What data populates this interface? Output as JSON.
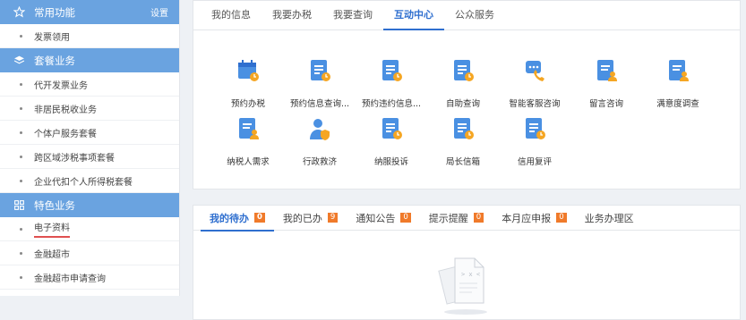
{
  "sidebar": {
    "sections": [
      {
        "title": "常用功能",
        "settings": "设置",
        "icon": "star-icon",
        "items": [
          "发票领用"
        ]
      },
      {
        "title": "套餐业务",
        "icon": "layers-icon",
        "items": [
          "代开发票业务",
          "非居民税收业务",
          "个体户服务套餐",
          "跨区域涉税事项套餐",
          "企业代扣个人所得税套餐"
        ]
      },
      {
        "title": "特色业务",
        "icon": "grid-icon",
        "items": [
          "电子资料",
          "金融超市",
          "金融超市申请查询"
        ]
      }
    ]
  },
  "top_tabs": [
    "我的信息",
    "我要办税",
    "我要查询",
    "互动中心",
    "公众服务"
  ],
  "active_top_tab": "互动中心",
  "services": [
    {
      "label": "预约办税",
      "icon": "calendar-clock-icon"
    },
    {
      "label": "预约信息查询...",
      "icon": "document-clock-icon"
    },
    {
      "label": "预约违约信息...",
      "icon": "document-clock-icon"
    },
    {
      "label": "自助查询",
      "icon": "document-clock-icon"
    },
    {
      "label": "智能客服咨询",
      "icon": "phone-chat-icon"
    },
    {
      "label": "留言咨询",
      "icon": "document-user-icon"
    },
    {
      "label": "满意度调查",
      "icon": "document-user-icon"
    },
    {
      "label": "纳税人需求",
      "icon": "document-user-icon"
    },
    {
      "label": "行政救济",
      "icon": "user-shield-icon"
    },
    {
      "label": "纳服投诉",
      "icon": "document-clock-icon"
    },
    {
      "label": "局长信箱",
      "icon": "document-clock-icon"
    },
    {
      "label": "信用复评",
      "icon": "document-clock-icon"
    }
  ],
  "bottom_tabs": [
    {
      "label": "我的待办",
      "badge": "0"
    },
    {
      "label": "我的已办",
      "badge": "9"
    },
    {
      "label": "通知公告",
      "badge": "0"
    },
    {
      "label": "提示提醒",
      "badge": "0"
    },
    {
      "label": "本月应申报",
      "badge": "0"
    },
    {
      "label": "业务办理区",
      "badge": ""
    }
  ],
  "colors": {
    "accent": "#2f6fcf",
    "sidebar_header": "#6aa3e0",
    "badge": "#f07a2a",
    "icon_blue": "#4a90e2",
    "icon_orange": "#f5a623"
  }
}
